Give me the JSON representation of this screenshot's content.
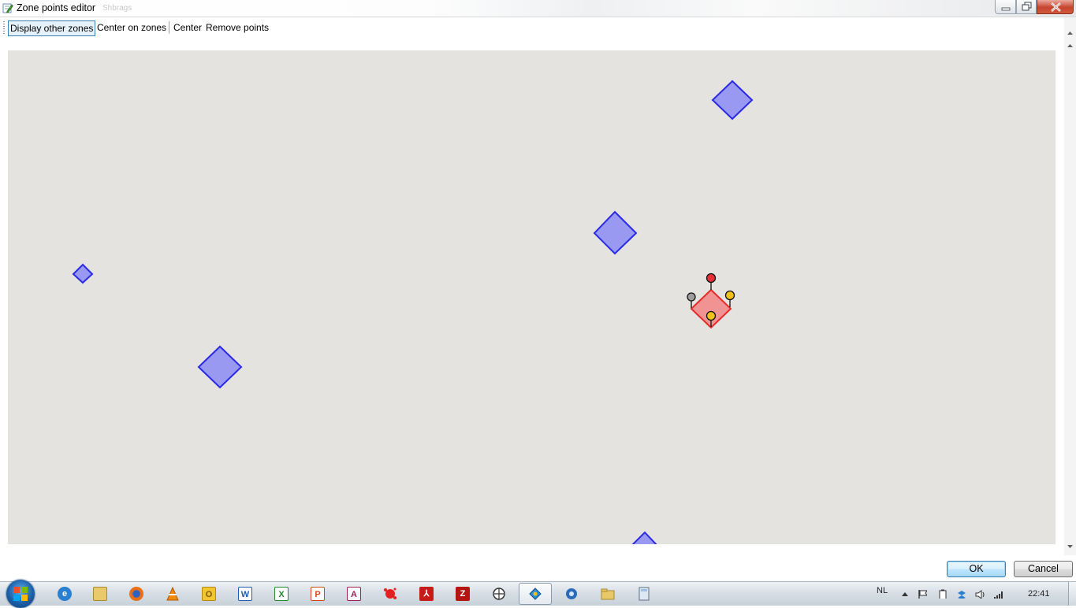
{
  "window": {
    "title": "Zone points editor",
    "title_ghost": "Shbrags"
  },
  "toolbar": {
    "display_other_zones": "Display other zones",
    "center_on_zones": "Center on zones",
    "center": "Center",
    "remove_points": "Remove points"
  },
  "map": {
    "background": "#e5e3df",
    "zone_fill": "#9999f2",
    "zone_stroke": "#2a2ae6",
    "selected_zone_fill": "#f29393",
    "selected_zone_stroke": "#e62a2a",
    "marker_colors": [
      "#e8303a",
      "#f2c21b",
      "#f2c21b",
      "#9e9e9e"
    ]
  },
  "buttons": {
    "ok": "OK",
    "cancel": "Cancel"
  },
  "taskbar": {
    "apps": [
      "internet-explorer-icon",
      "windows-explorer-icon",
      "firefox-icon",
      "vlc-icon",
      "outlook-icon",
      "word-icon",
      "excel-icon",
      "powerpoint-icon",
      "access-icon",
      "app-splash-icon",
      "acrobat-icon",
      "filezilla-icon",
      "network-icon",
      "zone-editor-icon",
      "settings-icon",
      "folder-icon",
      "calculator-icon"
    ],
    "tray": {
      "language": "NL",
      "time": "22:41"
    }
  }
}
